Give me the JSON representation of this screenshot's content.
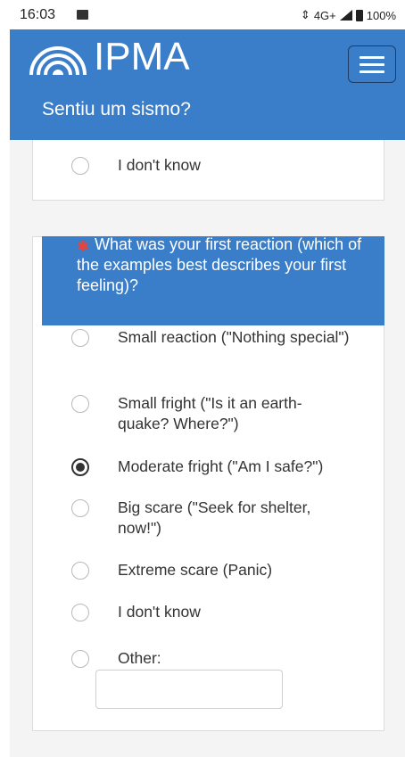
{
  "status_bar": {
    "time": "16:03",
    "network": "4G+",
    "battery": "100%"
  },
  "header": {
    "logo_text": "IPMA",
    "page_title": "Sentiu um sismo?",
    "menu_icon": "hamburger-menu-icon"
  },
  "previous_question": {
    "options": [
      {
        "label": "I don't know",
        "checked": false
      }
    ]
  },
  "question": {
    "required_icon": "asterisk",
    "text": "What was your first reaction (which of the examples best describes your first feeling)?",
    "options": [
      {
        "label": "Small reaction (\"Nothing special\")",
        "checked": false
      },
      {
        "label": "Small fright (\"Is it an earth-quake? Where?\")",
        "checked": false
      },
      {
        "label": "Moderate fright (\"Am I safe?\")",
        "checked": true
      },
      {
        "label": "Big scare (\"Seek for shelter, now!\")",
        "checked": false
      },
      {
        "label": "Extreme scare (Panic)",
        "checked": false
      },
      {
        "label": "I don't know",
        "checked": false
      },
      {
        "label": "Other:",
        "checked": false
      }
    ],
    "other_value": ""
  },
  "colors": {
    "brand_blue": "#3a7dc9",
    "required_red": "#e8443a"
  }
}
